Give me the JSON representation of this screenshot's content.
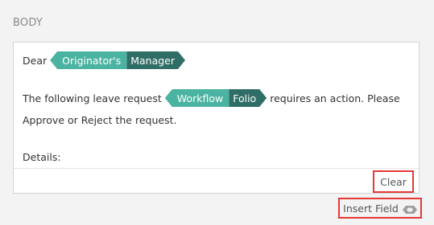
{
  "section": {
    "title": "BODY"
  },
  "editor": {
    "line1_text": "Dear",
    "field1": {
      "part1": "Originator's",
      "part2": "Manager"
    },
    "line2_pre": "The following leave request",
    "field2": {
      "part1": "Workflow",
      "part2": "Folio"
    },
    "line2_post": "requires an action. Please",
    "line3_text": "Approve or Reject the request.",
    "line4_text": "Details:"
  },
  "footer": {
    "clear_label": "Clear"
  },
  "insert": {
    "label": "Insert Field",
    "icon": "field-token-icon"
  },
  "colors": {
    "token_light": "#4bb3a1",
    "token_dark": "#2f6e66",
    "highlight_border": "#e53935"
  }
}
